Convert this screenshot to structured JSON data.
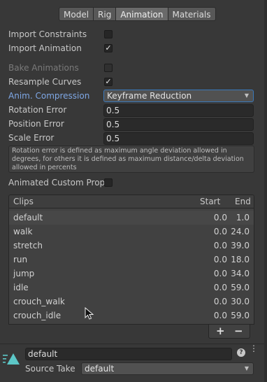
{
  "tabs": [
    "Model",
    "Rig",
    "Animation",
    "Materials"
  ],
  "active_tab": "Animation",
  "options": {
    "import_constraints": {
      "label": "Import Constraints",
      "checked": false
    },
    "import_animation": {
      "label": "Import Animation",
      "checked": true
    },
    "bake_animations": {
      "label": "Bake Animations",
      "checked": false
    },
    "resample_curves": {
      "label": "Resample Curves",
      "checked": true
    },
    "anim_compression": {
      "label": "Anim. Compression",
      "value": "Keyframe Reduction"
    },
    "rotation_error": {
      "label": "Rotation Error",
      "value": "0.5"
    },
    "position_error": {
      "label": "Position Error",
      "value": "0.5"
    },
    "scale_error": {
      "label": "Scale Error",
      "value": "0.5"
    },
    "help_text": "Rotation error is defined as maximum angle deviation allowed in degrees, for others it is defined as maximum distance/delta deviation allowed in percents",
    "animated_custom_props": {
      "label": "Animated Custom Prope",
      "checked": false
    }
  },
  "clips": {
    "headers": {
      "clips": "Clips",
      "start": "Start",
      "end": "End"
    },
    "rows": [
      {
        "name": "default",
        "start": "0.0",
        "end": "1.0"
      },
      {
        "name": "walk",
        "start": "0.0",
        "end": "24.0"
      },
      {
        "name": "stretch",
        "start": "0.0",
        "end": "39.0"
      },
      {
        "name": "run",
        "start": "0.0",
        "end": "18.0"
      },
      {
        "name": "jump",
        "start": "0.0",
        "end": "34.0"
      },
      {
        "name": "idle",
        "start": "0.0",
        "end": "59.0"
      },
      {
        "name": "crouch_walk",
        "start": "0.0",
        "end": "30.0"
      },
      {
        "name": "crouch_idle",
        "start": "0.0",
        "end": "59.0"
      }
    ],
    "add_label": "+",
    "remove_label": "−"
  },
  "selected_clip": {
    "name": "default",
    "source_take_label": "Source Take",
    "source_take_value": "default"
  },
  "colors": {
    "accent": "#4a82c4",
    "clip_icon": "#5cc7c7"
  }
}
